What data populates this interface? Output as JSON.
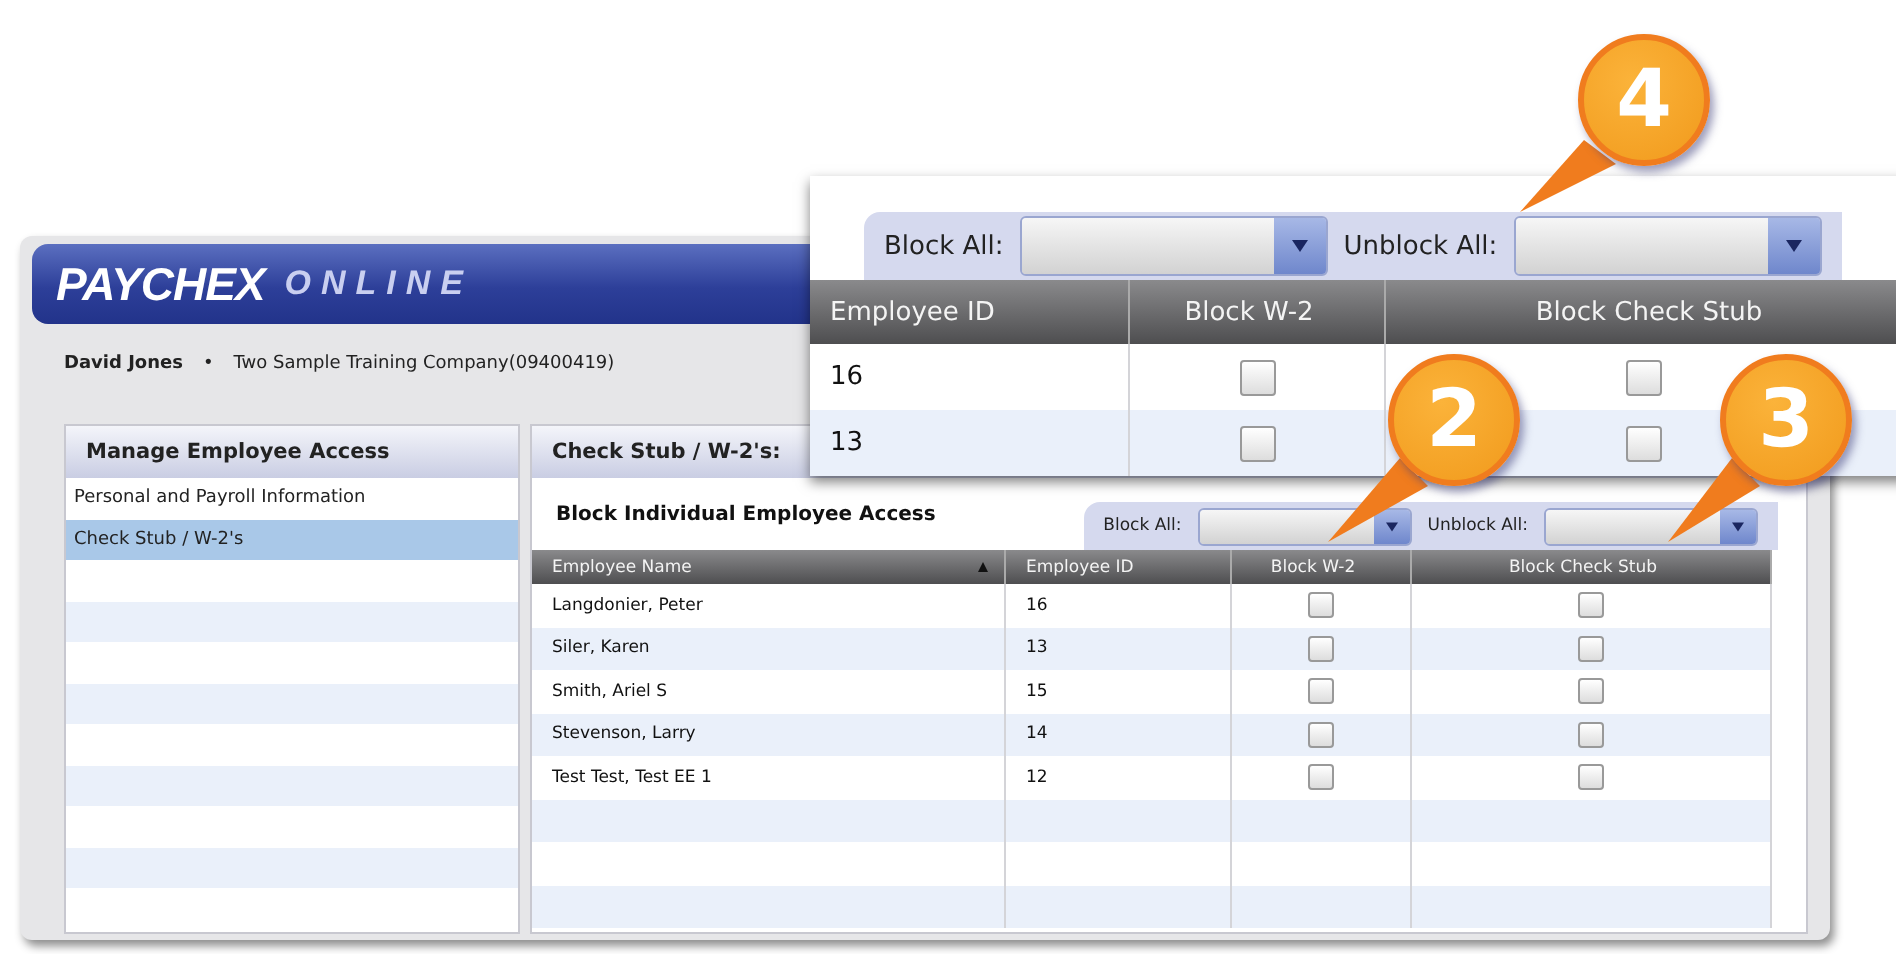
{
  "header": {
    "logo_primary": "PAYCHEX",
    "logo_secondary": "ONLINE"
  },
  "user": {
    "name": "David Jones",
    "separator": "•",
    "company": "Two Sample Training Company(09400419)"
  },
  "sidebar": {
    "title": "Manage Employee Access",
    "items": [
      {
        "label": "Personal and Payroll Information",
        "selected": false
      },
      {
        "label": "Check Stub / W-2's",
        "selected": true
      }
    ]
  },
  "content": {
    "title": "Check Stub / W-2's:",
    "section_title": "Block Individual Employee Access",
    "filters": [
      {
        "label": "Block All:"
      },
      {
        "label": "Unblock All:"
      }
    ],
    "table": {
      "columns": [
        {
          "label": "Employee Name",
          "sorted": true
        },
        {
          "label": "Employee ID",
          "sorted": false
        },
        {
          "label": "Block W-2",
          "sorted": false
        },
        {
          "label": "Block Check Stub",
          "sorted": false
        }
      ],
      "rows": [
        {
          "name": "Langdonier, Peter",
          "id": "16",
          "block_w2": false,
          "block_check_stub": false
        },
        {
          "name": "Siler, Karen",
          "id": "13",
          "block_w2": false,
          "block_check_stub": false
        },
        {
          "name": "Smith, Ariel S",
          "id": "15",
          "block_w2": false,
          "block_check_stub": false
        },
        {
          "name": "Stevenson, Larry",
          "id": "14",
          "block_w2": false,
          "block_check_stub": false
        },
        {
          "name": "Test Test, Test EE 1",
          "id": "12",
          "block_w2": false,
          "block_check_stub": false
        }
      ]
    }
  },
  "zoom_inset": {
    "filters": [
      {
        "label": "Block All:"
      },
      {
        "label": "Unblock All:"
      }
    ],
    "columns": [
      {
        "label": "Employee ID"
      },
      {
        "label": "Block W-2"
      },
      {
        "label": "Block Check Stub"
      }
    ],
    "rows": [
      {
        "id": "16",
        "block_w2": false,
        "block_check_stub": false
      },
      {
        "id": "13",
        "block_w2": false,
        "block_check_stub": false
      }
    ]
  },
  "callouts": [
    {
      "number": "4"
    },
    {
      "number": "2"
    },
    {
      "number": "3"
    }
  ]
}
